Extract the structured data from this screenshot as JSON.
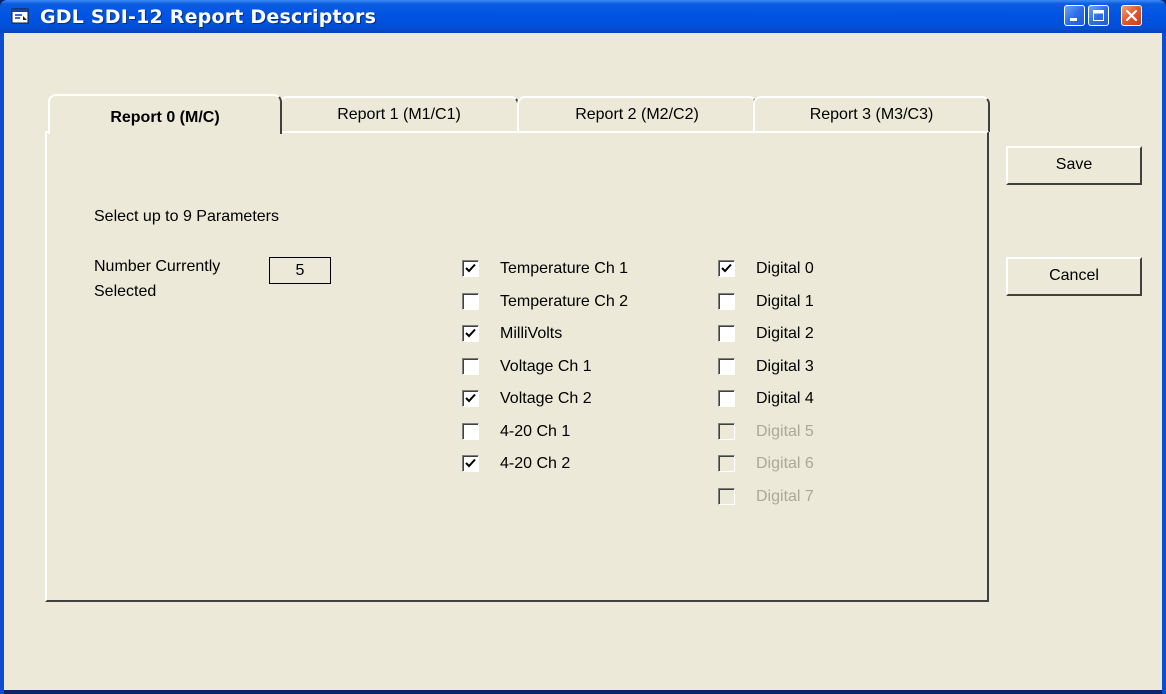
{
  "window": {
    "title": "GDL SDI-12 Report Descriptors"
  },
  "tabs": [
    {
      "label": "Report 0 (M/C)",
      "active": true
    },
    {
      "label": "Report 1 (M1/C1)",
      "active": false
    },
    {
      "label": "Report 2 (M2/C2)",
      "active": false
    },
    {
      "label": "Report 3 (M3/C3)",
      "active": false
    }
  ],
  "panel": {
    "select_hint": "Select up to 9 Parameters",
    "count_label_line1": "Number Currently",
    "count_label_line2": "Selected",
    "count_value": "5"
  },
  "parameters_left": [
    {
      "label": "Temperature Ch 1",
      "checked": true,
      "enabled": true
    },
    {
      "label": "Temperature Ch 2",
      "checked": false,
      "enabled": true
    },
    {
      "label": "MilliVolts",
      "checked": true,
      "enabled": true
    },
    {
      "label": "Voltage Ch 1",
      "checked": false,
      "enabled": true
    },
    {
      "label": "Voltage Ch 2",
      "checked": true,
      "enabled": true
    },
    {
      "label": "4-20 Ch 1",
      "checked": false,
      "enabled": true
    },
    {
      "label": "4-20 Ch 2",
      "checked": true,
      "enabled": true
    }
  ],
  "parameters_right": [
    {
      "label": "Digital 0",
      "checked": true,
      "enabled": true
    },
    {
      "label": "Digital 1",
      "checked": false,
      "enabled": true
    },
    {
      "label": "Digital 2",
      "checked": false,
      "enabled": true
    },
    {
      "label": "Digital 3",
      "checked": false,
      "enabled": true
    },
    {
      "label": "Digital 4",
      "checked": false,
      "enabled": true
    },
    {
      "label": "Digital 5",
      "checked": false,
      "enabled": false
    },
    {
      "label": "Digital 6",
      "checked": false,
      "enabled": false
    },
    {
      "label": "Digital 7",
      "checked": false,
      "enabled": false
    }
  ],
  "buttons": {
    "save_label": "Save",
    "cancel_label": "Cancel"
  },
  "colors": {
    "titlebar": "#0054e3",
    "face": "#ece9d8",
    "disabled_text": "#aca899"
  },
  "icons": {
    "app": "window-app-icon",
    "minimize": "minimize-icon",
    "maximize": "maximize-icon",
    "close": "close-icon"
  }
}
